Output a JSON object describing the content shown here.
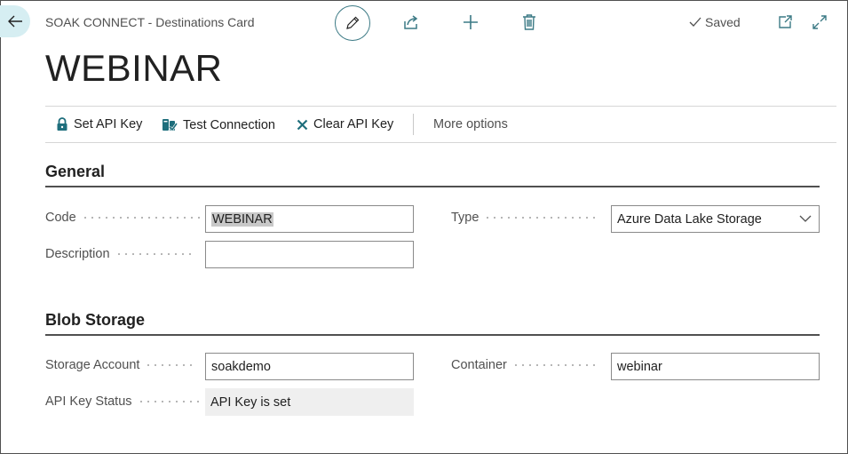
{
  "header": {
    "breadcrumb": "SOAK CONNECT - Destinations Card",
    "saved_label": "Saved"
  },
  "toolbar": {
    "icons": [
      "edit-pencil-icon",
      "share-icon",
      "plus-icon",
      "trash-icon",
      "open-new-window-icon",
      "expand-icon"
    ]
  },
  "page": {
    "title": "WEBINAR"
  },
  "actions": {
    "set_api_key": "Set API Key",
    "test_connection": "Test Connection",
    "clear_api_key": "Clear API Key",
    "more_options": "More options"
  },
  "general": {
    "title": "General",
    "code_label": "Code",
    "code_value": "WEBINAR",
    "description_label": "Description",
    "description_value": "",
    "type_label": "Type",
    "type_value": "Azure Data Lake Storage"
  },
  "blob": {
    "title": "Blob Storage",
    "storage_account_label": "Storage Account",
    "storage_account_value": "soakdemo",
    "container_label": "Container",
    "container_value": "webinar",
    "api_key_status_label": "API Key Status",
    "api_key_status_value": "API Key is set"
  },
  "colors": {
    "accent": "#3c7a85",
    "back_button_bg": "#d6eef2",
    "readonly_bg": "#efefef"
  }
}
